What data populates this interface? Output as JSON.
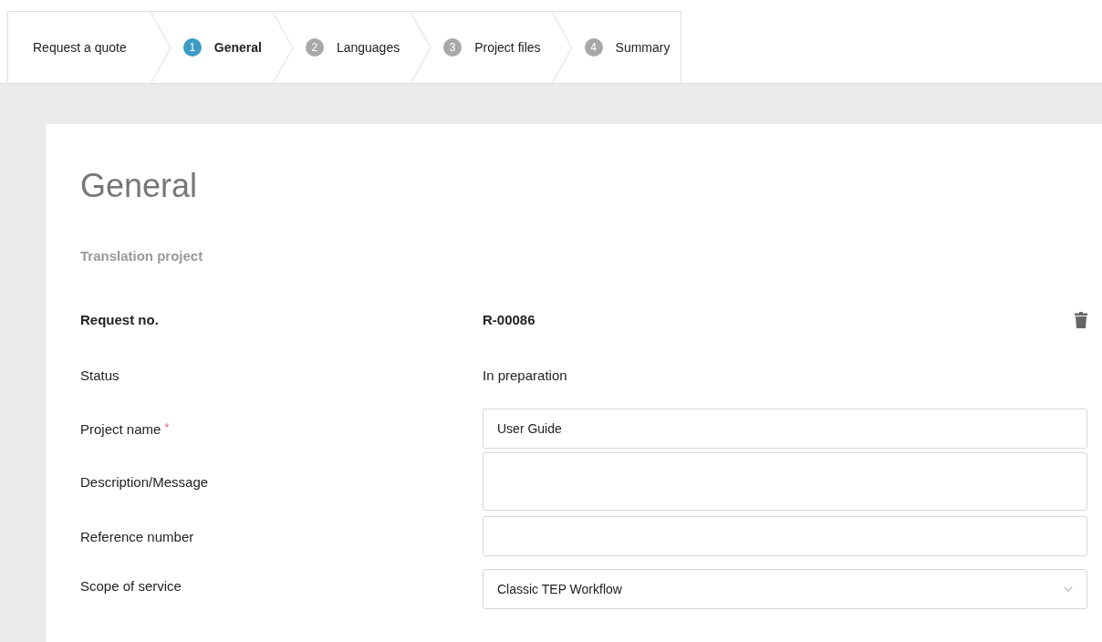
{
  "steps": [
    {
      "kind": "title",
      "label": "Request a quote",
      "selected": false
    },
    {
      "kind": "step",
      "number": "1",
      "label": "General",
      "selected": true
    },
    {
      "kind": "step",
      "number": "2",
      "label": "Languages",
      "selected": false
    },
    {
      "kind": "step",
      "number": "3",
      "label": "Project files",
      "selected": false
    },
    {
      "kind": "step",
      "number": "4",
      "label": "Summary",
      "selected": false
    }
  ],
  "card": {
    "title": "General",
    "section": "Translation project",
    "fields": [
      {
        "kind": "static",
        "label": "Request no.",
        "value": "R-00086",
        "bold": true,
        "deletable": true
      },
      {
        "kind": "static",
        "label": "Status",
        "value": "In preparation",
        "bold": false
      },
      {
        "kind": "input",
        "label": "Project name",
        "required_mark": "*",
        "value": "User Guide"
      },
      {
        "kind": "textarea",
        "label": "Description/Message"
      },
      {
        "kind": "input",
        "label": "Reference number"
      },
      {
        "kind": "select",
        "label": "Scope of service",
        "value": "Classic TEP Workflow"
      }
    ]
  }
}
